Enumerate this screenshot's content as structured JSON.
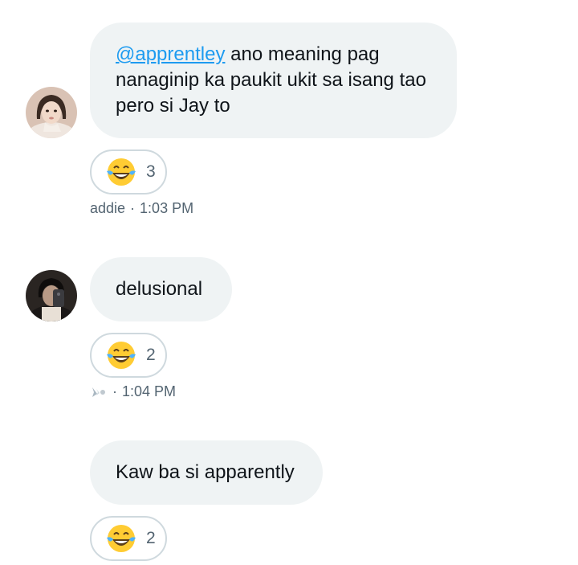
{
  "messages": [
    {
      "mention": "@apprentley",
      "text_line1": " ano meaning pag",
      "text_line2": "nanaginip ka paukit ukit sa isang tao",
      "text_line3": "pero si Jay to",
      "reaction_emoji": "face-with-tears-of-joy",
      "reaction_count": "3",
      "author": "addie",
      "separator": "·",
      "time": "1:03 PM"
    },
    {
      "text": "delusional",
      "reaction_emoji": "face-with-tears-of-joy",
      "reaction_count": "2",
      "author_icon": "sparkle-name-icon",
      "separator": "·",
      "time": "1:04 PM"
    },
    {
      "text": "Kaw ba si apparently",
      "reaction_emoji": "face-with-tears-of-joy",
      "reaction_count": "2"
    }
  ],
  "colors": {
    "bubble_bg": "#eff3f4",
    "mention": "#1d9bf0",
    "meta_text": "#536471",
    "reaction_border": "#cfd9de"
  }
}
